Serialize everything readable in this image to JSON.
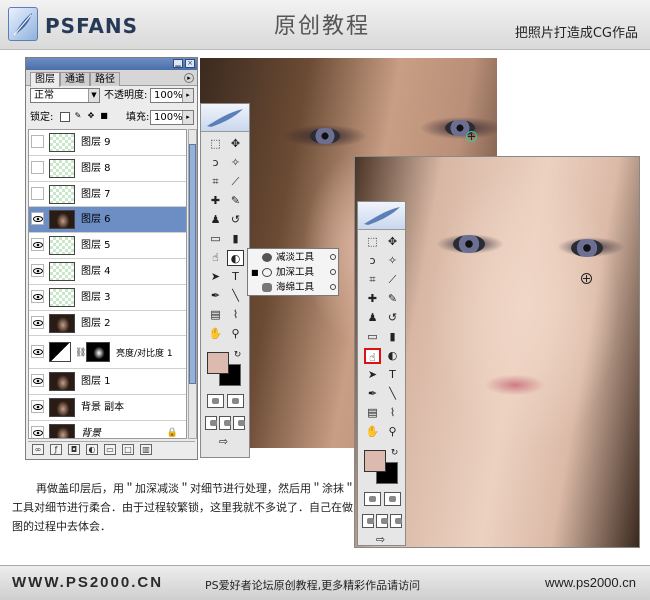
{
  "header": {
    "logo_text": "PSFANS",
    "title": "原创教程",
    "subtitle": "把照片打造成CG作品"
  },
  "layers_panel": {
    "tabs": [
      {
        "label": "图层",
        "active": true
      },
      {
        "label": "通道",
        "active": false
      },
      {
        "label": "路径",
        "active": false
      }
    ],
    "blend_mode": "正常",
    "opacity_label": "不透明度:",
    "opacity_value": "100%",
    "lock_label": "锁定:",
    "fill_label": "填充:",
    "fill_value": "100%",
    "layers": [
      {
        "name": "图层 9",
        "visible": false,
        "thumb": "transparent",
        "selected": false
      },
      {
        "name": "图层 8",
        "visible": false,
        "thumb": "transparent",
        "selected": false
      },
      {
        "name": "图层 7",
        "visible": false,
        "thumb": "transparent",
        "selected": false
      },
      {
        "name": "图层 6",
        "visible": true,
        "thumb": "photo",
        "selected": true
      },
      {
        "name": "图层 5",
        "visible": true,
        "thumb": "transparent",
        "selected": false
      },
      {
        "name": "图层 4",
        "visible": true,
        "thumb": "transparent",
        "selected": false
      },
      {
        "name": "图层 3",
        "visible": true,
        "thumb": "transparent",
        "selected": false
      },
      {
        "name": "图层 2",
        "visible": true,
        "thumb": "photo",
        "selected": false
      }
    ],
    "adjustment_layer": {
      "name": "亮度/对比度 1",
      "visible": true
    },
    "bottom_layers": [
      {
        "name": "图层 1",
        "visible": true
      },
      {
        "name": "背景 副本",
        "visible": true
      },
      {
        "name": "背景",
        "visible": true,
        "locked": true
      }
    ]
  },
  "tool_flyout": {
    "items": [
      {
        "label": "减淡工具",
        "selected": false
      },
      {
        "label": "加深工具",
        "selected": true
      },
      {
        "label": "海绵工具",
        "selected": false
      }
    ]
  },
  "colors": {
    "foreground": "#dcbab0",
    "background": "#000000",
    "selection_highlight": "#6d8ec4"
  },
  "description": "再做盖印层后，用＂加深减淡＂对细节进行处理，然后用＂涂抹＂工具对细节进行柔合．由于过程较繁锁，这里我就不多说了．自己在做图的过程中去体会．",
  "footer": {
    "site_logo": "WWW.PS2000.CN",
    "slogan": "PS爱好者论坛原创教程,更多精彩作品请访问",
    "url": "www.ps2000.cn"
  }
}
